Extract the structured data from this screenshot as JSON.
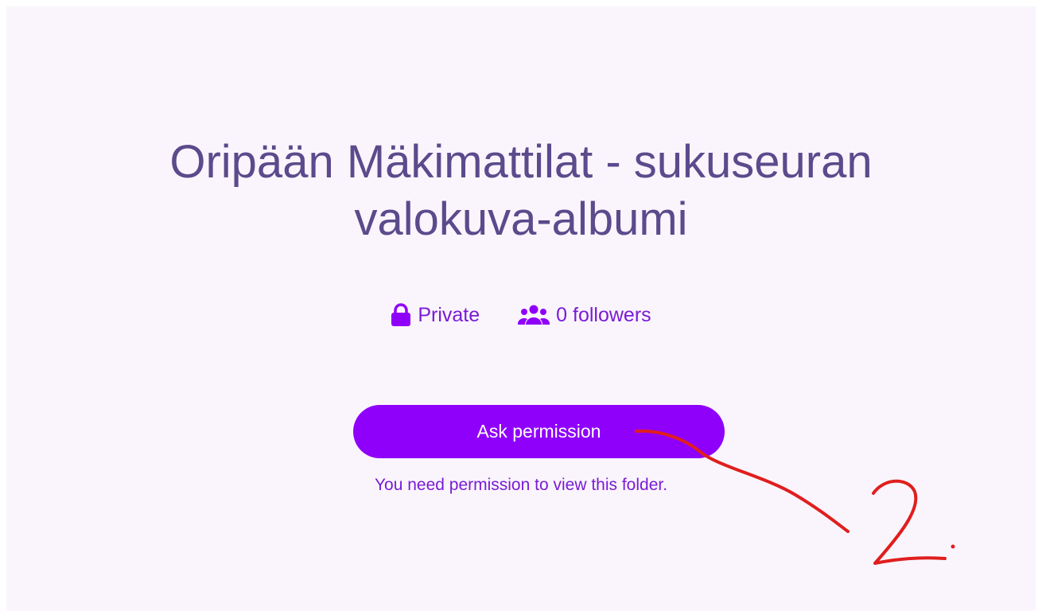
{
  "folder": {
    "title_line1": "Oripään Mäkimattilat - sukuseuran",
    "title_line2": "valokuva-albumi",
    "privacy_label": "Private",
    "followers_label": "0 followers",
    "privacy_icon": "lock-icon",
    "followers_icon": "users-icon"
  },
  "actions": {
    "ask_permission_label": "Ask permission"
  },
  "messages": {
    "permission_note": "You need permission to view this folder."
  },
  "annotation": {
    "step_number": "2."
  },
  "colors": {
    "page_background": "#faf5fc",
    "title_text": "#5b4a8c",
    "accent_purple": "#8f00fb",
    "meta_text": "#7a1bd6",
    "annotation_red": "#e01e1e"
  }
}
